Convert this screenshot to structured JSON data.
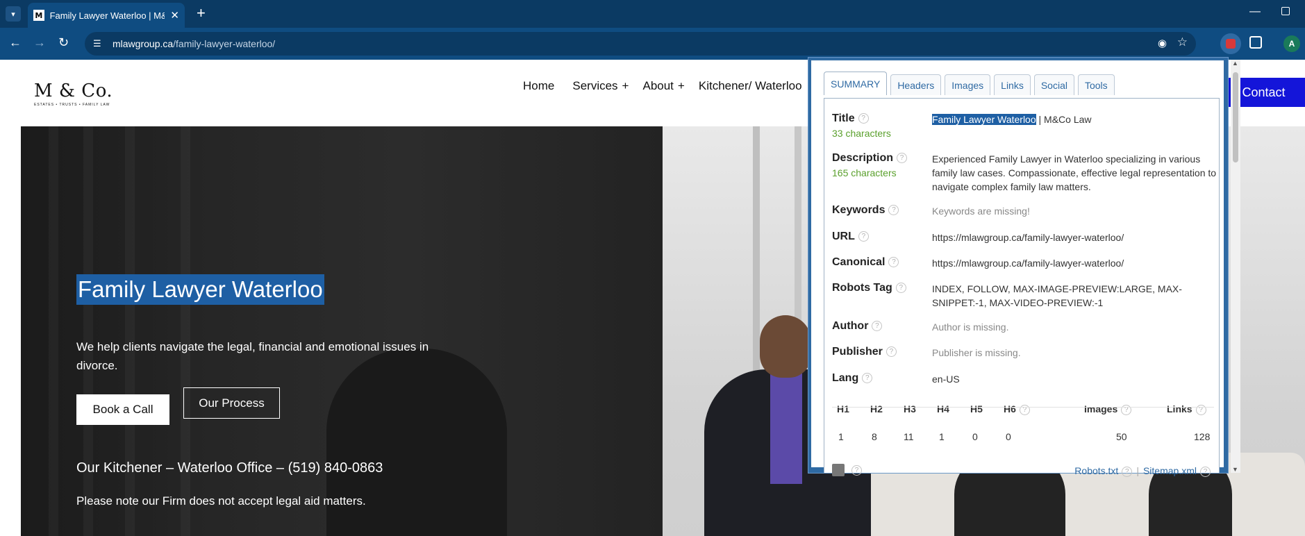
{
  "browser": {
    "tab_title": "Family Lawyer Waterloo | M&Co Law",
    "tab_favicon": "M",
    "url_host": "mlawgroup.ca",
    "url_path": "/family-lawyer-waterloo/",
    "avatar_letter": "A",
    "icons": [
      "chevron-down-icon",
      "close-icon",
      "plus-icon",
      "back-arrow-icon",
      "forward-arrow-icon",
      "reload-icon",
      "site-info-icon",
      "eye-off-icon",
      "star-icon",
      "extension-icon",
      "puzzle-icon",
      "minimize-icon",
      "restore-icon"
    ]
  },
  "site": {
    "logo_main": "M & Co.",
    "logo_sub": "ESTATES • TRUSTS • FAMILY LAW",
    "nav": [
      {
        "label": "Home",
        "plus": ""
      },
      {
        "label": "Services",
        "plus": "+"
      },
      {
        "label": "About",
        "plus": "+"
      },
      {
        "label": "Kitchener/ Waterloo",
        "plus": ""
      }
    ],
    "contact_label": "Contact",
    "hero_title": "Family Lawyer Waterloo",
    "hero_sub": "We help clients navigate the legal, financial and emotional issues in divorce.",
    "btn_book": "Book a Call",
    "btn_process": "Our Process",
    "office": "Our Kitchener – Waterloo Office –  (519) 840-0863",
    "note": "Please note our Firm does not accept legal aid matters."
  },
  "seo": {
    "tabs": [
      "SUMMARY",
      "Headers",
      "Images",
      "Links",
      "Social",
      "Tools"
    ],
    "title_label": "Title",
    "title_count": "33 characters",
    "title_highlight": "Family Lawyer Waterloo",
    "title_rest": " | M&Co Law",
    "desc_label": "Description",
    "desc_count": "165 characters",
    "desc_value": "Experienced Family Lawyer in Waterloo specializing in various family law cases. Compassionate, effective legal representation to navigate complex family law matters.",
    "keywords_label": "Keywords",
    "keywords_value": "Keywords are missing!",
    "url_label": "URL",
    "url_value": "https://mlawgroup.ca/family-lawyer-waterloo/",
    "canonical_label": "Canonical",
    "canonical_value": "https://mlawgroup.ca/family-lawyer-waterloo/",
    "robots_label": "Robots Tag",
    "robots_value": "INDEX, FOLLOW, MAX-IMAGE-PREVIEW:LARGE, MAX-SNIPPET:-1, MAX-VIDEO-PREVIEW:-1",
    "author_label": "Author",
    "author_value": "Author is missing.",
    "publisher_label": "Publisher",
    "publisher_value": "Publisher is missing.",
    "lang_label": "Lang",
    "lang_value": "en-US",
    "help_glyph": "?",
    "headers": {
      "h1_label": "H1",
      "h2_label": "H2",
      "h3_label": "H3",
      "h4_label": "H4",
      "h5_label": "H5",
      "h6_label": "H6",
      "images_label": "Images",
      "links_label": "Links",
      "h1": "1",
      "h2": "8",
      "h3": "11",
      "h4": "1",
      "h5": "0",
      "h6": "0",
      "images": "50",
      "links": "128"
    },
    "robots_txt": "Robots.txt",
    "sitemap": "Sitemap.xml"
  }
}
